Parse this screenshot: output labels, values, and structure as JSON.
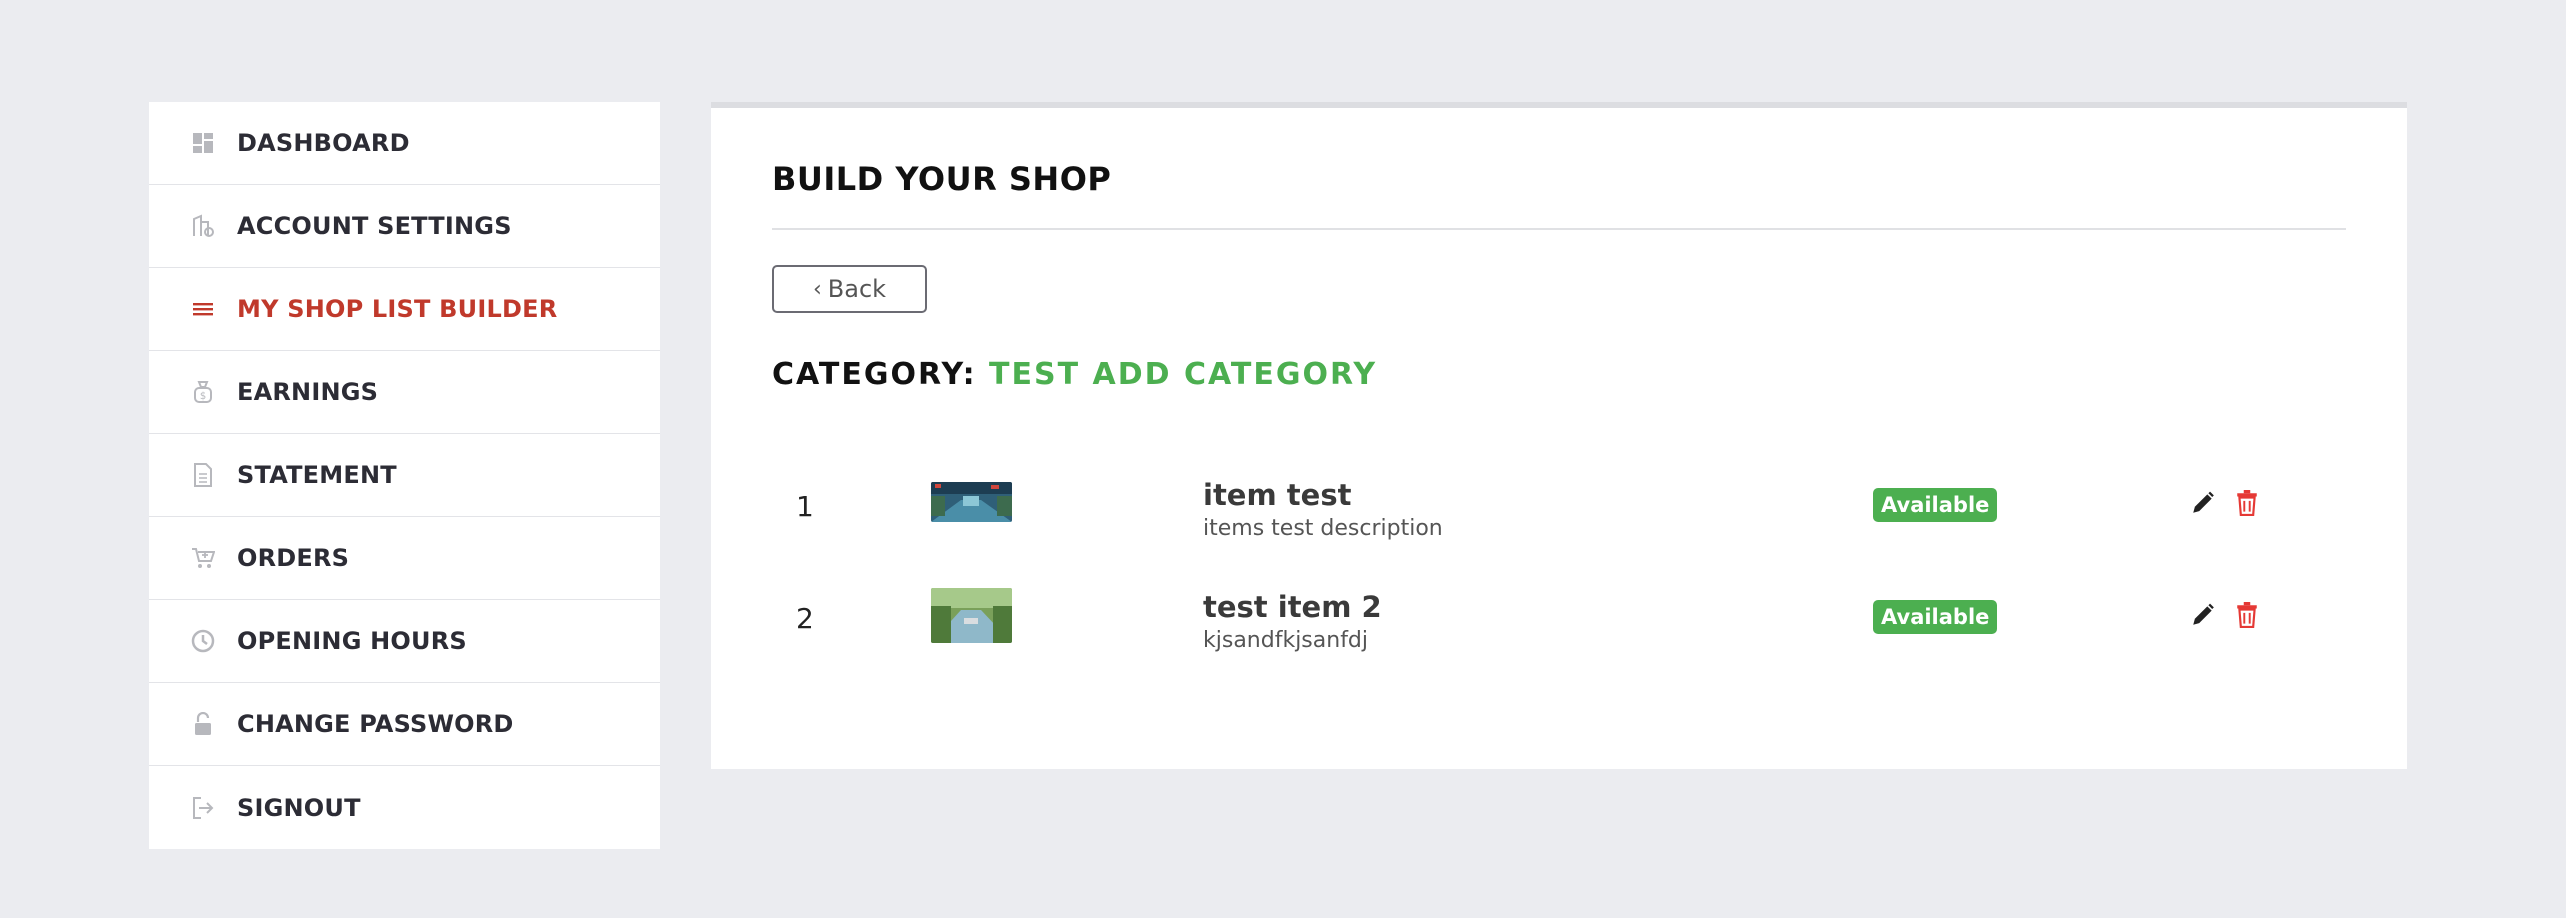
{
  "sidebar": {
    "items": [
      {
        "label": "DASHBOARD",
        "icon": "dashboard-icon",
        "active": false
      },
      {
        "label": "ACCOUNT SETTINGS",
        "icon": "account-settings-icon",
        "active": false
      },
      {
        "label": "MY SHOP LIST BUILDER",
        "icon": "list-icon",
        "active": true
      },
      {
        "label": "EARNINGS",
        "icon": "money-bag-icon",
        "active": false
      },
      {
        "label": "STATEMENT",
        "icon": "document-icon",
        "active": false
      },
      {
        "label": "ORDERS",
        "icon": "cart-icon",
        "active": false
      },
      {
        "label": "OPENING HOURS",
        "icon": "clock-icon",
        "active": false
      },
      {
        "label": "CHANGE PASSWORD",
        "icon": "lock-icon",
        "active": false
      },
      {
        "label": "SIGNOUT",
        "icon": "signout-icon",
        "active": false
      }
    ],
    "active_color": "#c0392b"
  },
  "main": {
    "title": "BUILD YOUR SHOP",
    "back_label": "Back",
    "category_prefix": "CATEGORY:",
    "category_name": "TEST ADD CATEGORY",
    "category_color": "#4caf50",
    "items": [
      {
        "number": "1",
        "name": "item test",
        "description": "items test description",
        "status": "Available"
      },
      {
        "number": "2",
        "name": "test item 2",
        "description": "kjsandfkjsanfdj",
        "status": "Available"
      }
    ]
  }
}
